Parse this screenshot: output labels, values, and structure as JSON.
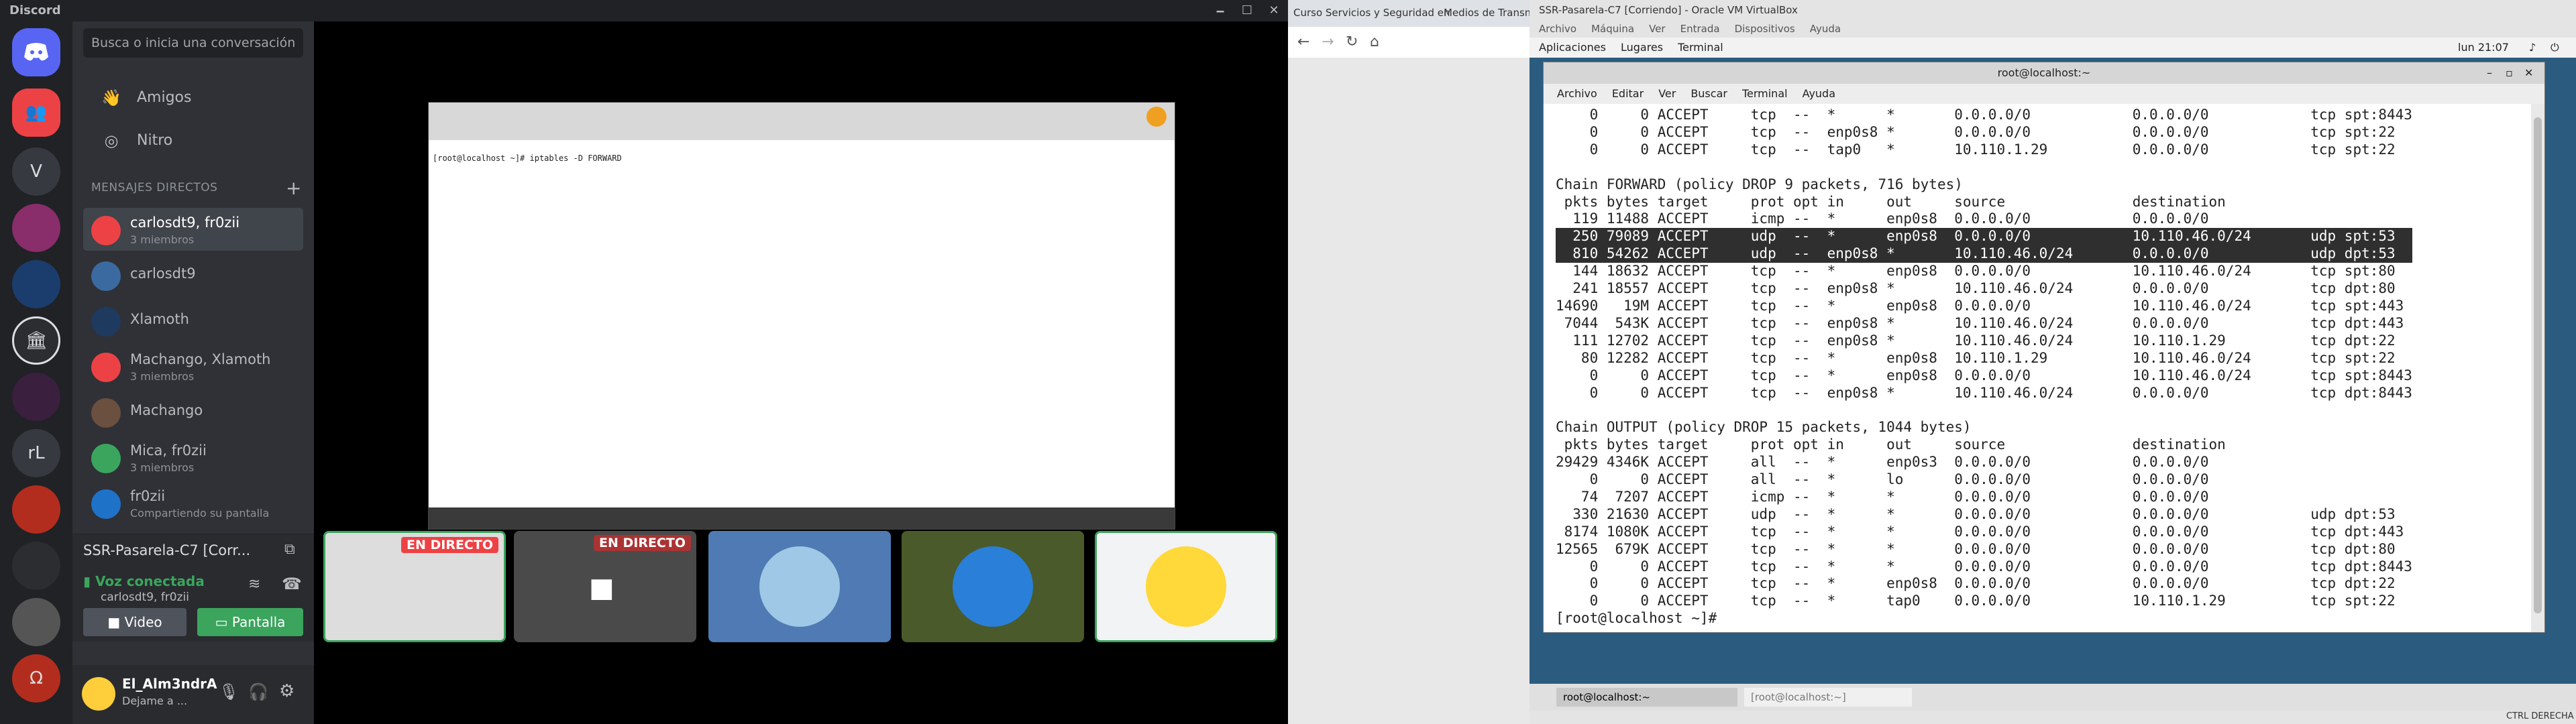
{
  "discord": {
    "title": "Discord",
    "window_buttons": [
      "🗕",
      "☐",
      "✕"
    ],
    "search_placeholder": "Busca o inicia una conversación",
    "nav": [
      {
        "label": "Amigos",
        "icon": "friends-icon"
      },
      {
        "label": "Nitro",
        "icon": "nitro-icon"
      }
    ],
    "dm_header": "MENSAJES DIRECTOS",
    "dms": [
      {
        "name": "carlosdt9, fr0zii",
        "sub": "3 miembros",
        "active": true,
        "color": "#ed4245"
      },
      {
        "name": "carlosdt9",
        "sub": "",
        "color": "#3b6aa0"
      },
      {
        "name": "Xlamoth",
        "sub": "",
        "color": "#1f3a5f"
      },
      {
        "name": "Machango, Xlamoth",
        "sub": "3 miembros",
        "color": "#ed4245"
      },
      {
        "name": "Machango",
        "sub": "",
        "color": "#6b4f3f"
      },
      {
        "name": "Mica, fr0zii",
        "sub": "3 miembros",
        "color": "#3ba55d"
      },
      {
        "name": "fr0zii",
        "sub": "Compartiendo su pantalla",
        "color": "#1e72c8"
      }
    ],
    "call": {
      "channel": "SSR-Pasarela-C7 [Corr...",
      "status": "Voz conectada",
      "members": "carlosdt9, fr0zii",
      "video_label": "Video",
      "screen_label": "Pantalla"
    },
    "user": {
      "name": "El_Alm3ndrA",
      "status": "Dejame a ..."
    },
    "guild_letters": [
      "V",
      "rL",
      "Ω"
    ],
    "tiles": [
      {
        "live": "EN DIRECTO"
      },
      {
        "live": "EN DIRECTO"
      },
      {
        "live": ""
      },
      {
        "live": ""
      },
      {
        "live": ""
      }
    ],
    "stream_cmd": "[root@localhost ~]# iptables -D FORWARD"
  },
  "browser": {
    "tab1": "Curso Servicios y Seguridad en",
    "tab2": "Medios de Transmisió"
  },
  "vbox": {
    "window_title": "SSR-Pasarela-C7 [Corriendo] - Oracle VM VirtualBox",
    "menu": [
      "Archivo",
      "Máquina",
      "Ver",
      "Entrada",
      "Dispositivos",
      "Ayuda"
    ],
    "gnome_bar": [
      "Aplicaciones",
      "Lugares",
      "Terminal"
    ],
    "clock": "lun 21:07",
    "terminal_title": "root@localhost:~",
    "terminal_menu": [
      "Archivo",
      "Editar",
      "Ver",
      "Buscar",
      "Terminal",
      "Ayuda"
    ],
    "lines": [
      "    0     0 ACCEPT     tcp  --  *      *       0.0.0.0/0            0.0.0.0/0            tcp spt:8443",
      "    0     0 ACCEPT     tcp  --  enp0s8 *       0.0.0.0/0            0.0.0.0/0            tcp spt:22",
      "    0     0 ACCEPT     tcp  --  tap0   *       10.110.1.29          0.0.0.0/0            tcp spt:22",
      "",
      "Chain FORWARD (policy DROP 9 packets, 716 bytes)",
      " pkts bytes target     prot opt in     out     source               destination",
      "  119 11488 ACCEPT     icmp --  *      enp0s8  0.0.0.0/0            0.0.0.0/0",
      "  250 79089 ACCEPT     udp  --  *      enp0s8  0.0.0.0/0            10.110.46.0/24       udp spt:53",
      "  810 54262 ACCEPT     udp  --  enp0s8 *       10.110.46.0/24       0.0.0.0/0            udp dpt:53",
      "  144 18632 ACCEPT     tcp  --  *      enp0s8  0.0.0.0/0            10.110.46.0/24       tcp spt:80",
      "  241 18557 ACCEPT     tcp  --  enp0s8 *       10.110.46.0/24       0.0.0.0/0            tcp dpt:80",
      "14690   19M ACCEPT     tcp  --  *      enp0s8  0.0.0.0/0            10.110.46.0/24       tcp spt:443",
      " 7044  543K ACCEPT     tcp  --  enp0s8 *       10.110.46.0/24       0.0.0.0/0            tcp dpt:443",
      "  111 12702 ACCEPT     tcp  --  enp0s8 *       10.110.46.0/24       10.110.1.29          tcp dpt:22",
      "   80 12282 ACCEPT     tcp  --  *      enp0s8  10.110.1.29          10.110.46.0/24       tcp spt:22",
      "    0     0 ACCEPT     tcp  --  *      enp0s8  0.0.0.0/0            10.110.46.0/24       tcp spt:8443",
      "    0     0 ACCEPT     tcp  --  enp0s8 *       10.110.46.0/24       0.0.0.0/0            tcp dpt:8443",
      "",
      "Chain OUTPUT (policy DROP 15 packets, 1044 bytes)",
      " pkts bytes target     prot opt in     out     source               destination",
      "29429 4346K ACCEPT     all  --  *      enp0s3  0.0.0.0/0            0.0.0.0/0",
      "    0     0 ACCEPT     all  --  *      lo      0.0.0.0/0            0.0.0.0/0",
      "   74  7207 ACCEPT     icmp --  *      *       0.0.0.0/0            0.0.0.0/0",
      "  330 21630 ACCEPT     udp  --  *      *       0.0.0.0/0            0.0.0.0/0            udp dpt:53",
      " 8174 1080K ACCEPT     tcp  --  *      *       0.0.0.0/0            0.0.0.0/0            tcp dpt:443",
      "12565  679K ACCEPT     tcp  --  *      *       0.0.0.0/0            0.0.0.0/0            tcp dpt:80",
      "    0     0 ACCEPT     tcp  --  *      *       0.0.0.0/0            0.0.0.0/0            tcp dpt:8443",
      "    0     0 ACCEPT     tcp  --  *      enp0s8  0.0.0.0/0            0.0.0.0/0            tcp dpt:22",
      "    0     0 ACCEPT     tcp  --  *      tap0    0.0.0.0/0            10.110.1.29          tcp spt:22",
      "[root@localhost ~]# "
    ],
    "taskbar": [
      "root@localhost:~",
      "[root@localhost:~]"
    ],
    "tray_text": "CTRL DERECHA"
  }
}
